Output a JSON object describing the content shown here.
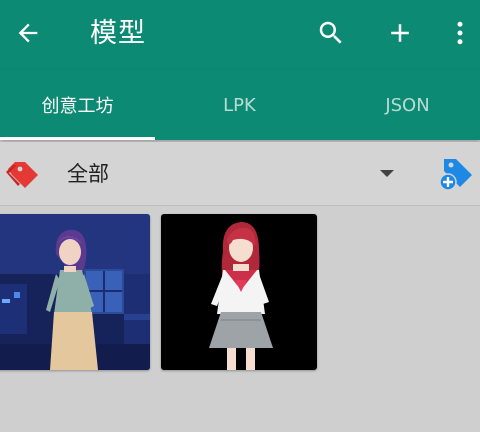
{
  "appbar": {
    "title": "模型",
    "back_icon": "arrow-left-icon",
    "actions": [
      "search-icon",
      "plus-icon",
      "more-vert-icon"
    ],
    "color": "#0c8a73"
  },
  "tabs": [
    {
      "label": "创意工坊",
      "active": true
    },
    {
      "label": "LPK",
      "active": false
    },
    {
      "label": "JSON",
      "active": false
    }
  ],
  "filter": {
    "icon": "tag-icon",
    "label": "全部",
    "dropdown_icon": "dropdown-arrow-icon",
    "add_icon": "add-tag-icon"
  },
  "models": [
    {
      "thumbnail": "purple-hair-girl-night-room",
      "background": "#1b2a6b"
    },
    {
      "thumbnail": "red-hair-girl-sailor-uniform",
      "background": "#000000"
    }
  ]
}
